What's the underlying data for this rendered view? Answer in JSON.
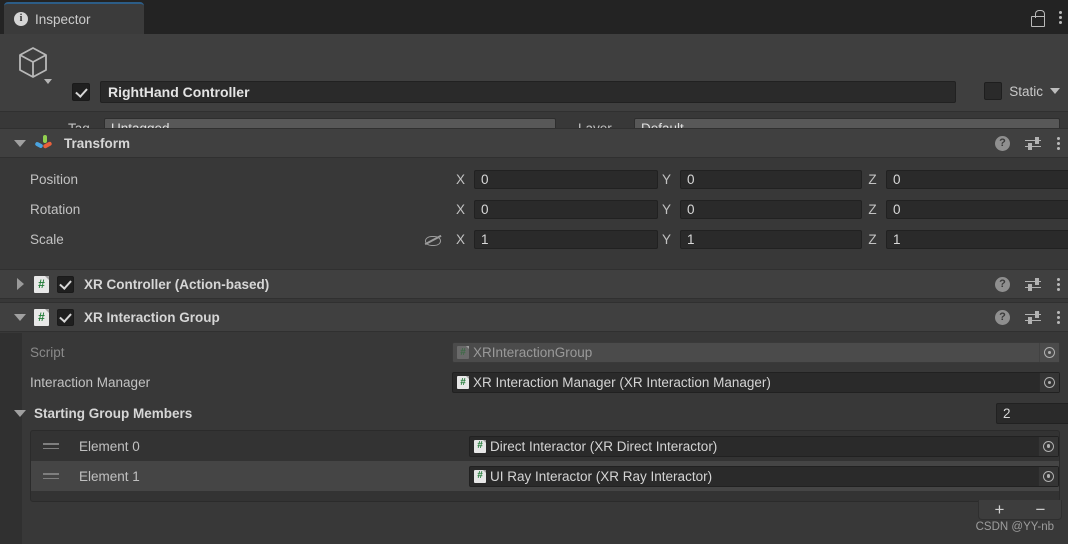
{
  "window": {
    "tab_label": "Inspector",
    "tab_icon": "info-icon",
    "lock_icon": "lock-icon",
    "menu_icon": "kebab-menu-icon"
  },
  "gameobject": {
    "icon": "cube-icon",
    "enabled": true,
    "name": "RightHand Controller",
    "static_label": "Static",
    "static_checked": false,
    "tag_label": "Tag",
    "tag_value": "Untagged",
    "layer_label": "Layer",
    "layer_value": "Default"
  },
  "components": [
    {
      "name": "Transform",
      "icon": "transform-gizmo-icon",
      "expanded": true,
      "has_enable_toggle": false,
      "rows": [
        {
          "label": "Position",
          "x": "0",
          "y": "0",
          "z": "0",
          "has_eye": false
        },
        {
          "label": "Rotation",
          "x": "0",
          "y": "0",
          "z": "0",
          "has_eye": false
        },
        {
          "label": "Scale",
          "x": "1",
          "y": "1",
          "z": "1",
          "has_eye": true
        }
      ],
      "axis_labels": {
        "x": "X",
        "y": "Y",
        "z": "Z"
      },
      "header_icons": [
        "help-icon",
        "preset-icon",
        "kebab-menu-icon"
      ]
    },
    {
      "name": "XR Controller (Action-based)",
      "icon": "script-icon",
      "expanded": false,
      "has_enable_toggle": true,
      "enabled": true,
      "header_icons": [
        "help-icon",
        "preset-icon",
        "kebab-menu-icon"
      ]
    },
    {
      "name": "XR Interaction Group",
      "icon": "script-icon",
      "expanded": true,
      "has_enable_toggle": true,
      "enabled": true,
      "header_icons": [
        "help-icon",
        "preset-icon",
        "kebab-menu-icon"
      ]
    }
  ],
  "interaction_group": {
    "script_label": "Script",
    "script_value": "XRInteractionGroup",
    "manager_label": "Interaction Manager",
    "manager_value": "XR Interaction Manager (XR Interaction Manager)",
    "members_label": "Starting Group Members",
    "members_count": "2",
    "members": [
      {
        "label": "Element 0",
        "value": "Direct Interactor (XR Direct Interactor)"
      },
      {
        "label": "Element 1",
        "value": "UI Ray Interactor (XR Ray Interactor)"
      }
    ],
    "add_button": "+",
    "remove_button": "−"
  },
  "watermark": "CSDN @YY-nb",
  "colors": {
    "accent_tab": "#2c5d87",
    "panel_bg": "#383838",
    "header_bg": "#404040",
    "field_bg": "#2a2a2a",
    "script_green": "#1f7a36",
    "axis_green": "#92d050",
    "axis_blue": "#4aa3df",
    "axis_red": "#e8603c"
  }
}
